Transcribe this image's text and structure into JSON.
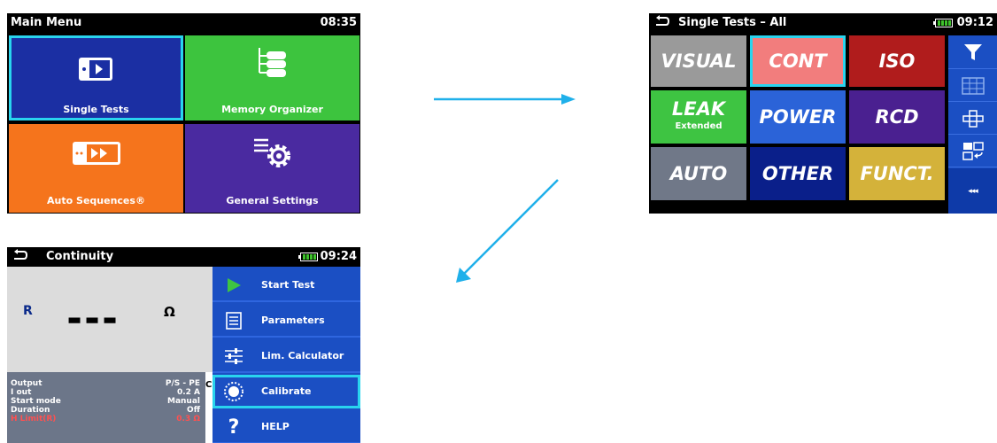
{
  "main_menu": {
    "title": "Main Menu",
    "time": "08:35",
    "tiles": [
      {
        "label": "Single Tests",
        "color": "#1b2fa3",
        "icon": "single-play-icon"
      },
      {
        "label": "Memory Organizer",
        "color": "#3dc43e",
        "icon": "tree-icon"
      },
      {
        "label": "Auto Sequences®",
        "color": "#f5741c",
        "icon": "fast-forward-icon"
      },
      {
        "label": "General Settings",
        "color": "#4a2aa0",
        "icon": "gear-menu-icon"
      }
    ]
  },
  "single_tests": {
    "title": "Single Tests – All",
    "time": "09:12",
    "tiles": [
      {
        "label": "VISUAL",
        "sub": "",
        "color": "#9a9a9a"
      },
      {
        "label": "CONT",
        "sub": "",
        "color": "#f27d7d"
      },
      {
        "label": "ISO",
        "sub": "",
        "color": "#b01c1c"
      },
      {
        "label": "LEAK",
        "sub": "Extended",
        "color": "#3ec442"
      },
      {
        "label": "POWER",
        "sub": "",
        "color": "#2b63d8"
      },
      {
        "label": "RCD",
        "sub": "",
        "color": "#4a2090"
      },
      {
        "label": "AUTO",
        "sub": "",
        "color": "#707888"
      },
      {
        "label": "OTHER",
        "sub": "",
        "color": "#0a1f8a"
      },
      {
        "label": "FUNCT.",
        "sub": "",
        "color": "#d4b23a"
      }
    ],
    "side_more": "◂◂◂"
  },
  "continuity": {
    "title": "Continuity",
    "time": "09:24",
    "result_label": "R",
    "result_value": "▬ ▬ ▬",
    "result_unit": "Ω",
    "extra_char": "C",
    "params": [
      {
        "name": "Output",
        "value": "P/S - PE",
        "color": "#ffffff"
      },
      {
        "name": "I out",
        "value": "0.2 A",
        "color": "#ffffff"
      },
      {
        "name": "Start mode",
        "value": "Manual",
        "color": "#ffffff"
      },
      {
        "name": "Duration",
        "value": "Off",
        "color": "#ffffff"
      },
      {
        "name": "H Limit(R)",
        "value": "0.3 Ω",
        "color": "#ff5050"
      }
    ],
    "menu": [
      {
        "label": "Start Test",
        "icon": "play-icon"
      },
      {
        "label": "Parameters",
        "icon": "list-icon"
      },
      {
        "label": "Lim. Calculator",
        "icon": "sliders-icon"
      },
      {
        "label": "Calibrate",
        "icon": "calibrate-icon"
      },
      {
        "label": "HELP",
        "icon": "help-icon"
      }
    ]
  },
  "colors": {
    "accent": "#29d4ee",
    "arrow": "#1fb0ea"
  }
}
